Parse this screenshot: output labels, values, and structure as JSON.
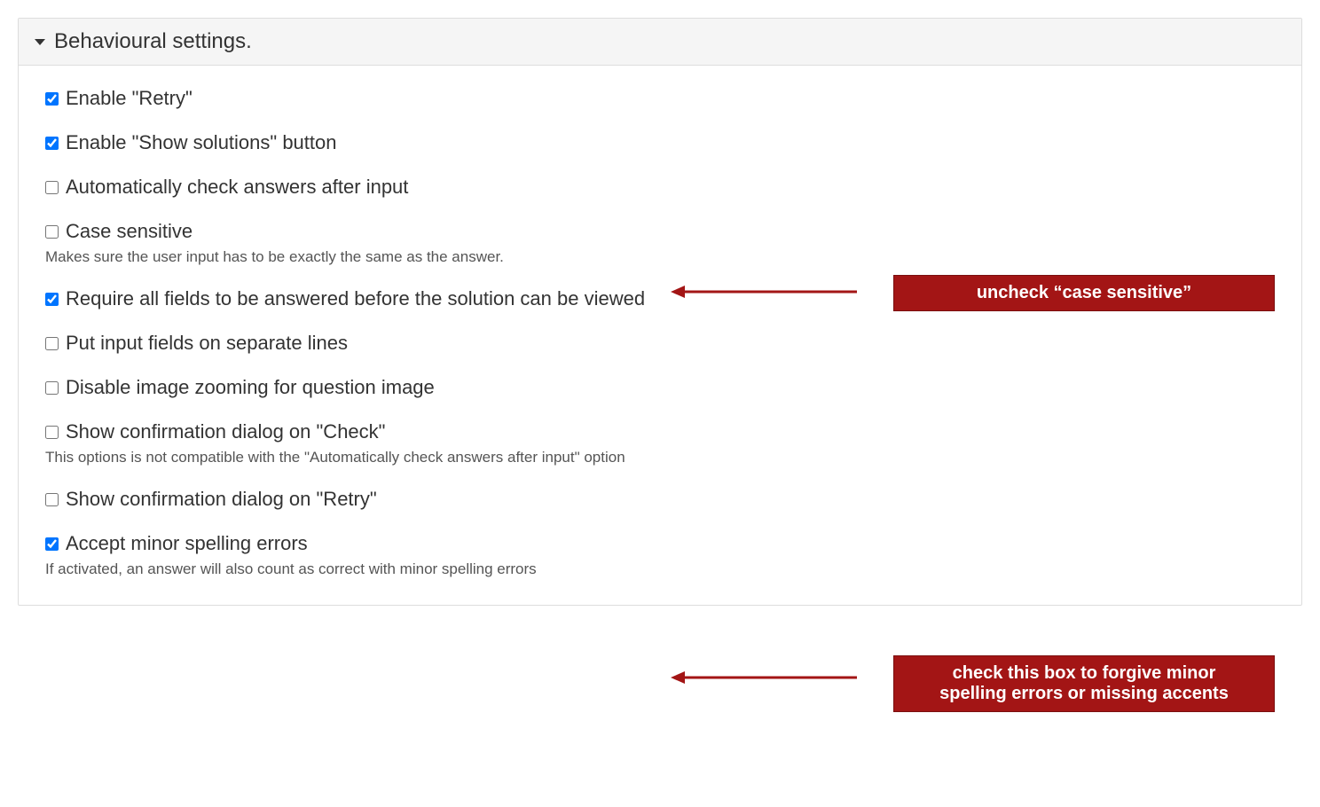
{
  "header": {
    "title": "Behavioural settings."
  },
  "fields": {
    "retry": {
      "label": "Enable \"Retry\"",
      "checked": true
    },
    "show_solutions": {
      "label": "Enable \"Show solutions\" button",
      "checked": true
    },
    "auto_check": {
      "label": "Automatically check answers after input",
      "checked": false
    },
    "case_sensitive": {
      "label": "Case sensitive",
      "checked": false,
      "desc": "Makes sure the user input has to be exactly the same as the answer."
    },
    "require_all": {
      "label": "Require all fields to be answered before the solution can be viewed",
      "checked": true
    },
    "separate_lines": {
      "label": "Put input fields on separate lines",
      "checked": false
    },
    "disable_zoom": {
      "label": "Disable image zooming for question image",
      "checked": false
    },
    "confirm_check": {
      "label": "Show confirmation dialog on \"Check\"",
      "checked": false,
      "desc": "This options is not compatible with the \"Automatically check answers after input\" option"
    },
    "confirm_retry": {
      "label": "Show confirmation dialog on \"Retry\"",
      "checked": false
    },
    "accept_spelling": {
      "label": "Accept minor spelling errors",
      "checked": true,
      "desc": "If activated, an answer will also count as correct with minor spelling errors"
    }
  },
  "callouts": {
    "case_sensitive": "uncheck “case sensitive”",
    "spelling_line1": "check this box to forgive minor",
    "spelling_line2": "spelling errors or missing accents"
  }
}
